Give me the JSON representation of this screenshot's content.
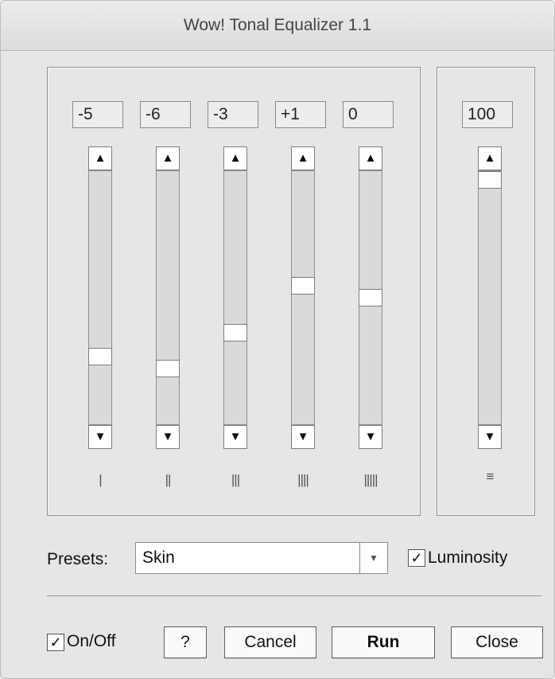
{
  "window": {
    "title": "Wow! Tonal Equalizer 1.1"
  },
  "bands": [
    {
      "value": "-5",
      "label": "|",
      "level": -5
    },
    {
      "value": "-6",
      "label": "||",
      "level": -6
    },
    {
      "value": "-3",
      "label": "|||",
      "level": -3
    },
    {
      "value": "+1",
      "label": "||||",
      "level": 1
    },
    {
      "value": "0",
      "label": "|||||",
      "level": 0
    }
  ],
  "master": {
    "value": "100",
    "label": "≡",
    "level": 100
  },
  "slider_icons": {
    "up": "▲",
    "down": "▼"
  },
  "presets": {
    "label": "Presets:",
    "selected": "Skin",
    "dropdown_icon": "▼"
  },
  "luminosity": {
    "label": "Luminosity",
    "checked": true,
    "check_glyph": "✓"
  },
  "onoff": {
    "label": "On/Off",
    "checked": true,
    "check_glyph": "✓"
  },
  "buttons": {
    "help": "?",
    "cancel": "Cancel",
    "run": "Run",
    "close": "Close"
  }
}
